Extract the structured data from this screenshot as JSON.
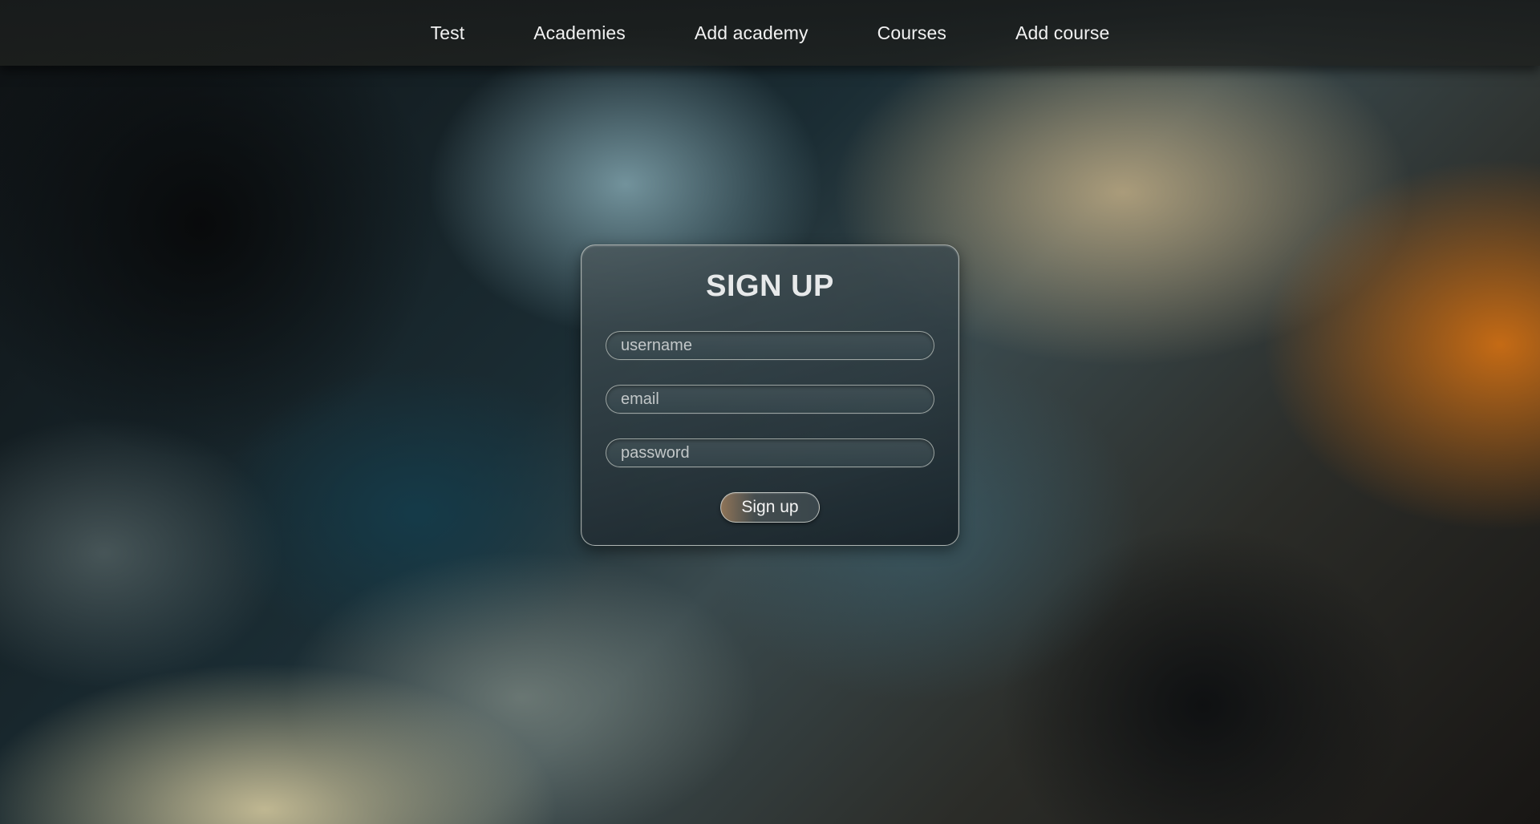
{
  "nav": {
    "items": [
      {
        "label": "Test"
      },
      {
        "label": "Academies"
      },
      {
        "label": "Add academy"
      },
      {
        "label": "Courses"
      },
      {
        "label": "Add course"
      }
    ]
  },
  "signup": {
    "title": "SIGN UP",
    "username": {
      "placeholder": "username",
      "value": ""
    },
    "email": {
      "placeholder": "email",
      "value": ""
    },
    "password": {
      "placeholder": "password",
      "value": ""
    },
    "submit_label": "Sign up"
  },
  "colors": {
    "text": "#f2f2f2",
    "accent_orange": "#cd6e14",
    "card_bg": "#2f3e44"
  }
}
